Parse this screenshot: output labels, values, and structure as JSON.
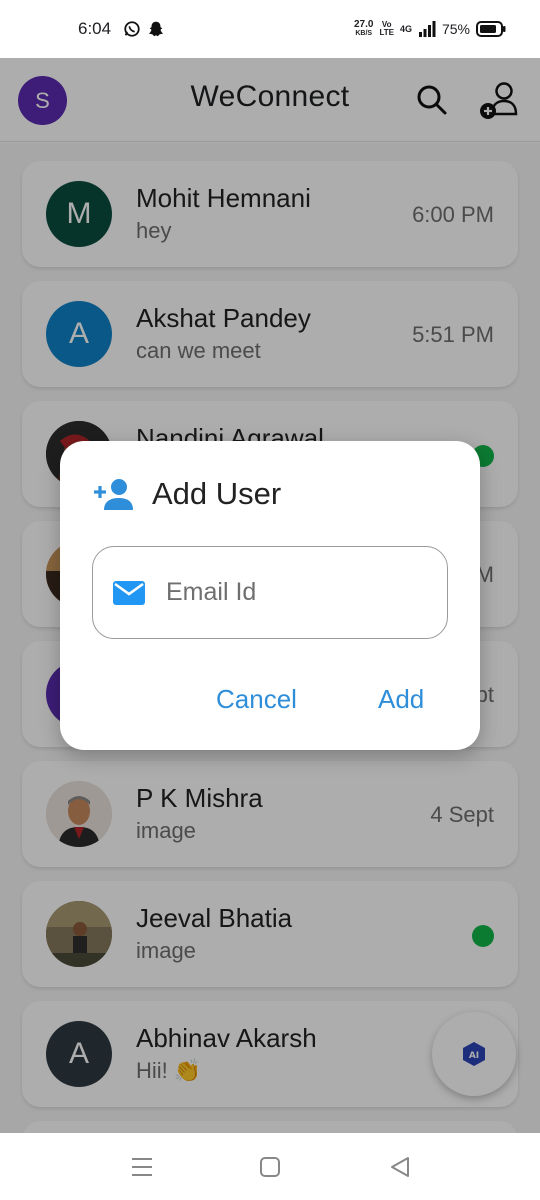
{
  "status_bar": {
    "time": "6:04",
    "speed_value": "27.0",
    "speed_unit": "KB/S",
    "volte_top": "Vo",
    "volte_bottom": "LTE",
    "network": "4G",
    "battery": "75%"
  },
  "app_bar": {
    "user_initial": "S",
    "title": "WeConnect"
  },
  "chats": [
    {
      "name": "Mohit Hemnani",
      "message": "hey",
      "time": "6:00 PM",
      "initial": "M",
      "color": "#0b4d3e"
    },
    {
      "name": "Akshat Pandey",
      "message": "can we meet",
      "time": "5:51 PM",
      "initial": "A",
      "color": "#0f82c8"
    },
    {
      "name": "Nandini Agrawal",
      "message": "",
      "time": "",
      "initial": "",
      "color": "#3a3a3a"
    },
    {
      "name": "",
      "message": "",
      "time": "M",
      "initial": "",
      "color": "#b57a3d"
    },
    {
      "name": "",
      "message": "",
      "time": "pt",
      "initial": "",
      "color": "#5b2bb0"
    },
    {
      "name": "P K Mishra",
      "message": "image",
      "time": "4 Sept",
      "initial": "",
      "color": "#d9a35f"
    },
    {
      "name": "Jeeval Bhatia",
      "message": "image",
      "time": "",
      "initial": "",
      "color": "#6b6049"
    },
    {
      "name": "Abhinav Akarsh",
      "message": "Hii! 👏",
      "time": "",
      "initial": "A",
      "color": "#2f3a43"
    }
  ],
  "fab": {
    "label": "AI"
  },
  "dialog": {
    "title": "Add User",
    "email_placeholder": "Email Id",
    "cancel_label": "Cancel",
    "add_label": "Add"
  },
  "colors": {
    "accent": "#2f8ed9",
    "online": "#12b54a"
  }
}
